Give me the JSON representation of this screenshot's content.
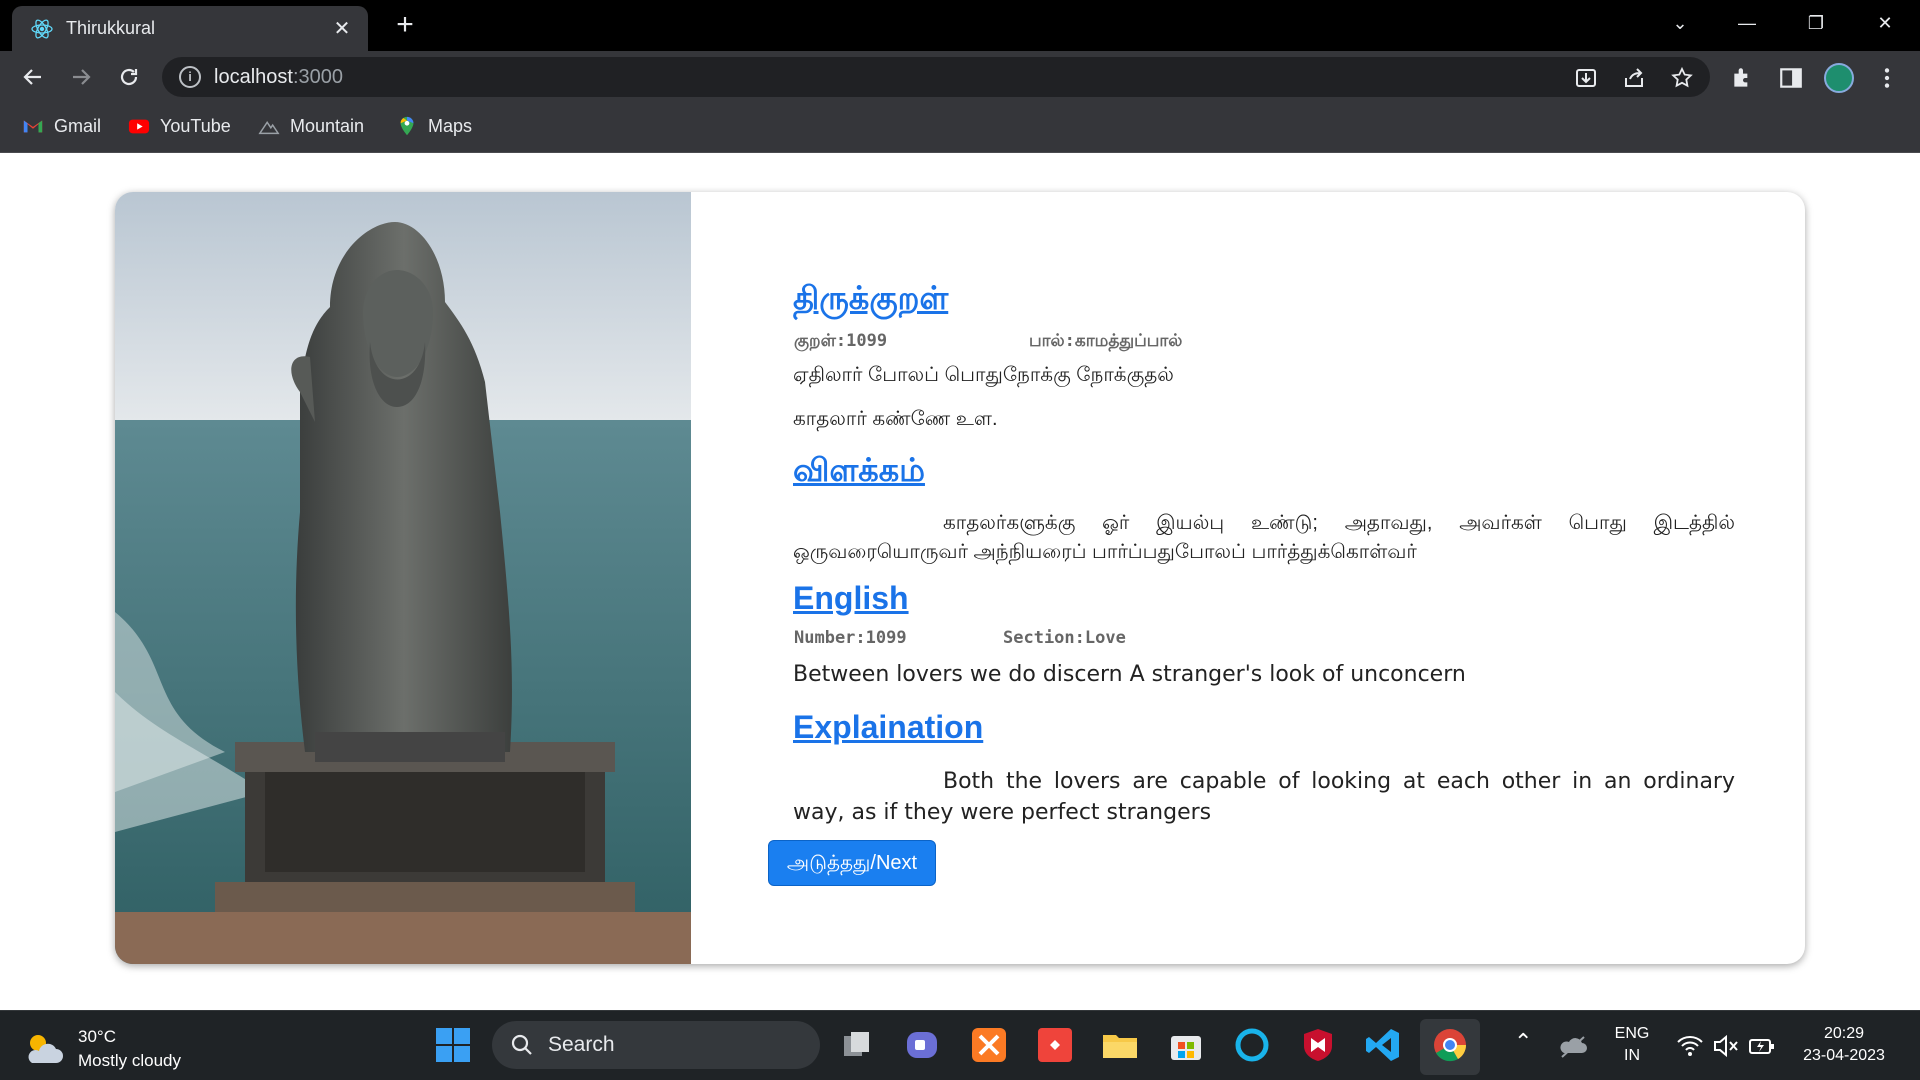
{
  "browser": {
    "tab_title": "Thirukkural",
    "url_host": "localhost",
    "url_port": ":3000",
    "bookmarks": [
      "Gmail",
      "YouTube",
      "Mountain",
      "Maps"
    ],
    "icons": [
      "react-favicon",
      "close-icon",
      "plus-icon",
      "back-arrow-icon",
      "forward-arrow-icon",
      "reload-icon",
      "info-icon",
      "install-icon",
      "share-icon",
      "star-icon",
      "extensions-icon",
      "sidepanel-icon",
      "profile-avatar",
      "menu-dots-icon"
    ]
  },
  "page": {
    "kural_heading": "திருக்குறள்",
    "kural_number": "குறள்:1099",
    "paal": "பால்:காமத்துப்பால்",
    "line1": "ஏதிலார் போலப் பொதுநோக்கு நோக்குதல்",
    "line2": "காதலார் கண்ணே உள.",
    "meaning_heading": "விளக்கம்",
    "meaning_text": "காதலர்களுக்கு ஓர் இயல்பு உண்டு; அதாவது, அவர்கள் பொது இடத்தில் ஒருவரையொருவர் அந்நியரைப் பார்ப்பதுபோலப் பார்த்துக்கொள்வர்",
    "english_heading": "English",
    "english_number": "Number:1099",
    "english_section": "Section:Love",
    "english_translation": "Between lovers we do discern A stranger's look of unconcern",
    "explanation_heading": "Explaination",
    "explanation_text": "Both the lovers are capable of looking at each other in an ordinary way, as if they were perfect strangers",
    "next_button": "அடுத்தது/Next"
  },
  "taskbar": {
    "temperature": "30°C",
    "weather": "Mostly cloudy",
    "search": "Search",
    "lang1": "ENG",
    "lang2": "IN",
    "time": "20:29",
    "date": "23-04-2023"
  },
  "colors": {
    "link_blue": "#1a73e8",
    "button_blue": "#1a7ff0",
    "chrome_dark": "#35363a"
  }
}
